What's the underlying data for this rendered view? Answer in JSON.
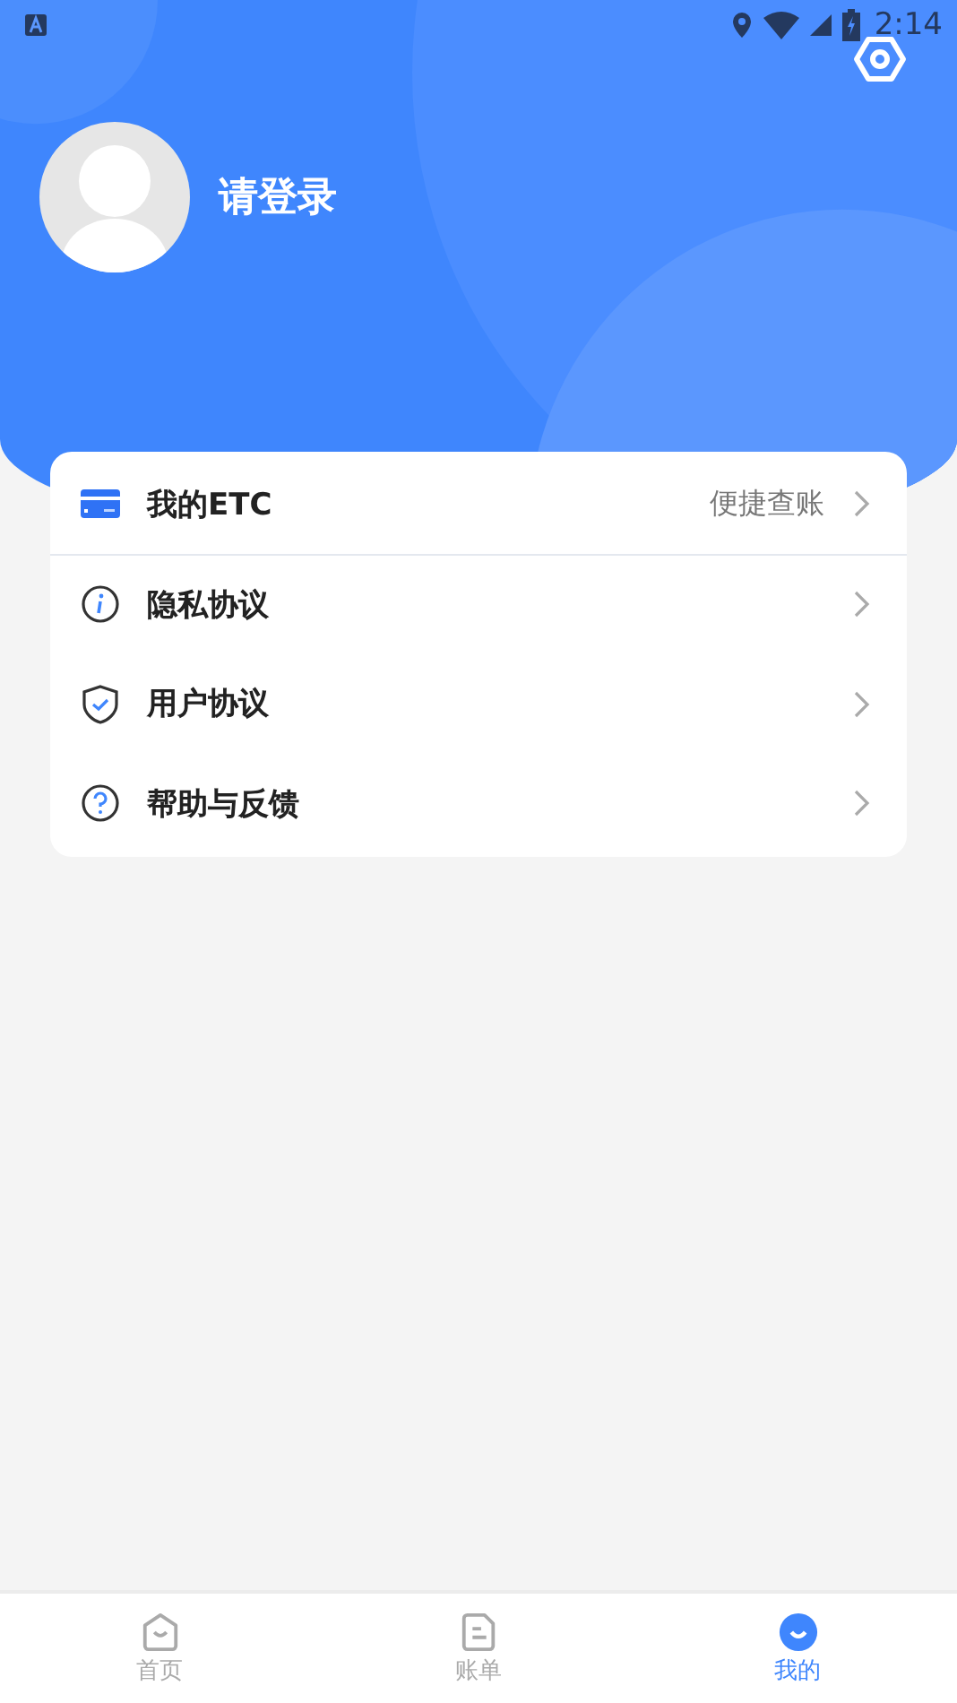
{
  "status_bar": {
    "time": "2:14"
  },
  "profile": {
    "name": "请登录"
  },
  "menu": [
    {
      "kind": "etc",
      "label": "我的ETC",
      "hint": "便捷查账"
    },
    {
      "kind": "info",
      "label": "隐私协议"
    },
    {
      "kind": "shield",
      "label": "用户协议"
    },
    {
      "kind": "help",
      "label": "帮助与反馈"
    }
  ],
  "tabs": [
    {
      "kind": "home",
      "label": "首页",
      "selected": false
    },
    {
      "kind": "bill",
      "label": "账单",
      "selected": false
    },
    {
      "kind": "me",
      "label": "我的",
      "selected": true
    }
  ]
}
